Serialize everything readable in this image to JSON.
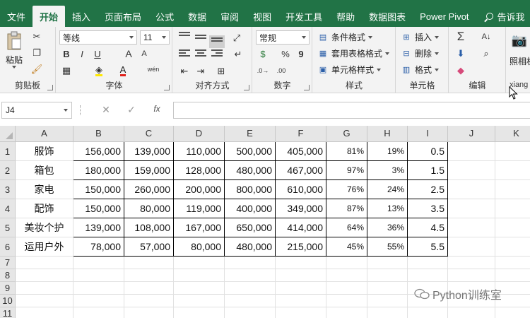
{
  "tabs": [
    "文件",
    "开始",
    "插入",
    "页面布局",
    "公式",
    "数据",
    "审阅",
    "视图",
    "开发工具",
    "帮助",
    "数据图表",
    "Power Pivot",
    "告诉我"
  ],
  "ribbon": {
    "clipboard": {
      "label": "剪贴板",
      "paste": "粘贴"
    },
    "font": {
      "label": "字体",
      "font_name": "等线",
      "font_size": "11",
      "bold": "B",
      "italic": "I",
      "underline": "U",
      "grow": "A",
      "shrink": "A",
      "wen": "wén",
      "font_color": "A"
    },
    "align": {
      "label": "对齐方式"
    },
    "number": {
      "label": "数字",
      "format": "常规",
      "percent": "%",
      "comma": "9"
    },
    "styles": {
      "label": "样式",
      "cond": "条件格式",
      "table": "套用表格格式",
      "cell": "单元格样式"
    },
    "cells": {
      "label": "单元格",
      "insert": "插入",
      "delete": "删除",
      "format": "格式"
    },
    "edit": {
      "label": "编辑"
    },
    "extra": {
      "label": "照相机",
      "sub": "xiang"
    }
  },
  "formula_bar": {
    "name_box": "J4",
    "cancel": "✕",
    "enter": "✓",
    "fx": "fx",
    "content": ""
  },
  "columns": [
    "A",
    "B",
    "C",
    "D",
    "E",
    "F",
    "G",
    "H",
    "I",
    "J",
    "K"
  ],
  "rows": [
    "1",
    "2",
    "3",
    "4",
    "5",
    "6",
    "7",
    "8",
    "9",
    "10",
    "11"
  ],
  "table": [
    [
      "服饰",
      "156,000",
      "139,000",
      "110,000",
      "500,000",
      "405,000",
      "81%",
      "19%",
      "0.5"
    ],
    [
      "箱包",
      "180,000",
      "159,000",
      "128,000",
      "480,000",
      "467,000",
      "97%",
      "3%",
      "1.5"
    ],
    [
      "家电",
      "150,000",
      "260,000",
      "200,000",
      "800,000",
      "610,000",
      "76%",
      "24%",
      "2.5"
    ],
    [
      "配饰",
      "150,000",
      "80,000",
      "119,000",
      "400,000",
      "349,000",
      "87%",
      "13%",
      "3.5"
    ],
    [
      "美妆个护",
      "139,000",
      "108,000",
      "167,000",
      "650,000",
      "414,000",
      "64%",
      "36%",
      "4.5"
    ],
    [
      "运用户外",
      "78,000",
      "57,000",
      "80,000",
      "480,000",
      "215,000",
      "45%",
      "55%",
      "5.5"
    ]
  ],
  "watermark": "Python训练室",
  "colors": {
    "ribbon_green": "#217346",
    "ribbon_bg": "#f3f3f3",
    "grid_line": "#e1e1e1"
  }
}
